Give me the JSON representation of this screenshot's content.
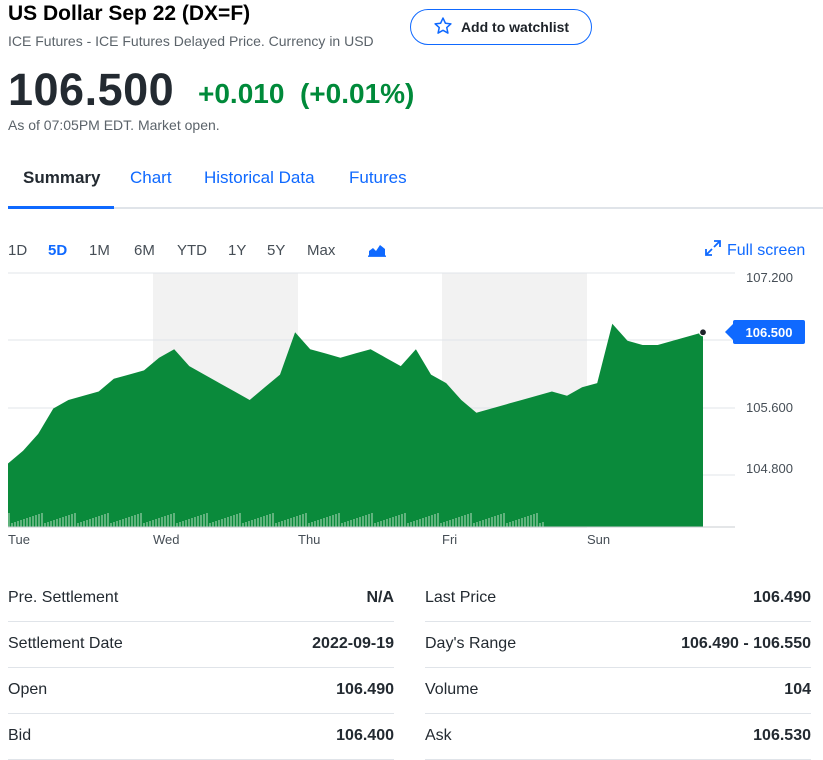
{
  "header": {
    "title": "US Dollar Sep 22 (DX=F)",
    "subtitle": "ICE Futures - ICE Futures Delayed Price. Currency in USD",
    "watchlist_label": "Add to watchlist"
  },
  "quote": {
    "price": "106.500",
    "change": "+0.010",
    "change_pct": "(+0.01%)",
    "as_of": "As of 07:05PM EDT. Market open."
  },
  "tabs": [
    "Summary",
    "Chart",
    "Historical Data",
    "Futures"
  ],
  "ranges": [
    "1D",
    "5D",
    "1M",
    "6M",
    "YTD",
    "1Y",
    "5Y",
    "Max"
  ],
  "active_range": "5D",
  "full_screen_label": "Full screen",
  "colors": {
    "accent": "#0f69ff",
    "up": "#008a3a",
    "chart_fill": "#0a8a3b"
  },
  "chart_data": {
    "type": "area",
    "x_labels": [
      "Tue",
      "Wed",
      "Thu",
      "Fri",
      "Sun"
    ],
    "y_ticks": [
      "107.200",
      "105.600",
      "104.800"
    ],
    "current_label": "106.500",
    "ylim": [
      104.2,
      107.2
    ],
    "series": [
      {
        "values": [
          104.95,
          105.1,
          105.3,
          105.6,
          105.7,
          105.75,
          105.8,
          105.95,
          106.0,
          106.05,
          106.2,
          106.3,
          106.1,
          106.0,
          105.9,
          105.8,
          105.7,
          105.85,
          106.0,
          106.5,
          106.3,
          106.25,
          106.2,
          106.25,
          106.3,
          106.2,
          106.1,
          106.3,
          106.0,
          105.9,
          105.7,
          105.55,
          105.6,
          105.65,
          105.7,
          105.75,
          105.8,
          105.75,
          105.85,
          105.9,
          106.6,
          106.4,
          106.35,
          106.35,
          106.4,
          106.45,
          106.5
        ]
      }
    ],
    "grid": true
  },
  "stats": [
    {
      "label": "Pre. Settlement",
      "value": "N/A"
    },
    {
      "label": "Last Price",
      "value": "106.490"
    },
    {
      "label": "Settlement Date",
      "value": "2022-09-19"
    },
    {
      "label": "Day's Range",
      "value": "106.490 - 106.550"
    },
    {
      "label": "Open",
      "value": "106.490"
    },
    {
      "label": "Volume",
      "value": "104"
    },
    {
      "label": "Bid",
      "value": "106.400"
    },
    {
      "label": "Ask",
      "value": "106.530"
    }
  ]
}
